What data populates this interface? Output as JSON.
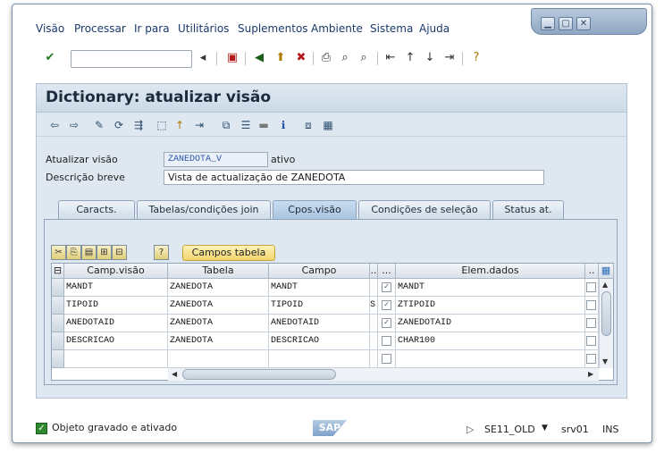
{
  "menubar": {
    "items": [
      "Visão",
      "Processar",
      "Ir para",
      "Utilitários",
      "Suplementos",
      "Ambiente",
      "Sistema",
      "Ajuda"
    ]
  },
  "window_controls": {
    "minimize": "▁",
    "maximize": "▢",
    "close": "✕"
  },
  "std_toolbar": {
    "command_value": ""
  },
  "screen": {
    "title": "Dictionary: atualizar visão"
  },
  "form": {
    "view_label": "Atualizar visão",
    "view_value": "ZANEDOTA_V",
    "view_status": "ativo",
    "desc_label": "Descrição breve",
    "desc_value": "Vista de actualização de ZANEDOTA"
  },
  "tabs": [
    "Caracts.",
    "Tabelas/condições join",
    "Cpos.visão",
    "Condições de seleção",
    "Status at."
  ],
  "active_tab": "Cpos.visão",
  "table_controls": {
    "campos_button": "Campos tabela"
  },
  "grid": {
    "headers": [
      "Camp.visão",
      "Tabela",
      "Campo",
      "..",
      "...",
      "Elem.dados",
      ".."
    ],
    "rows": [
      {
        "campo_visao": "MANDT",
        "tabela": "ZANEDOTA",
        "campo": "MANDT",
        "flag1": "",
        "checked": true,
        "elem": "MANDT"
      },
      {
        "campo_visao": "TIPOID",
        "tabela": "ZANEDOTA",
        "campo": "TIPOID",
        "flag1": "S",
        "checked": true,
        "elem": "ZTIPOID"
      },
      {
        "campo_visao": "ANEDOTAID",
        "tabela": "ZANEDOTA",
        "campo": "ANEDOTAID",
        "flag1": "",
        "checked": true,
        "elem": "ZANEDOTAID"
      },
      {
        "campo_visao": "DESCRICAO",
        "tabela": "ZANEDOTA",
        "campo": "DESCRICAO",
        "flag1": "",
        "checked": false,
        "elem": "CHAR100"
      },
      {
        "campo_visao": "",
        "tabela": "",
        "campo": "",
        "flag1": "",
        "checked": false,
        "elem": ""
      }
    ]
  },
  "statusbar": {
    "message": "Objeto gravado e ativado",
    "logo": "SAP",
    "transaction": "SE11_OLD",
    "server": "srv01",
    "mode": "INS"
  },
  "colors": {
    "panel": "#dfe8f1",
    "active_tab": "#a9c4df",
    "button": "#f1d46b",
    "title_text": "#1b2b3c"
  }
}
